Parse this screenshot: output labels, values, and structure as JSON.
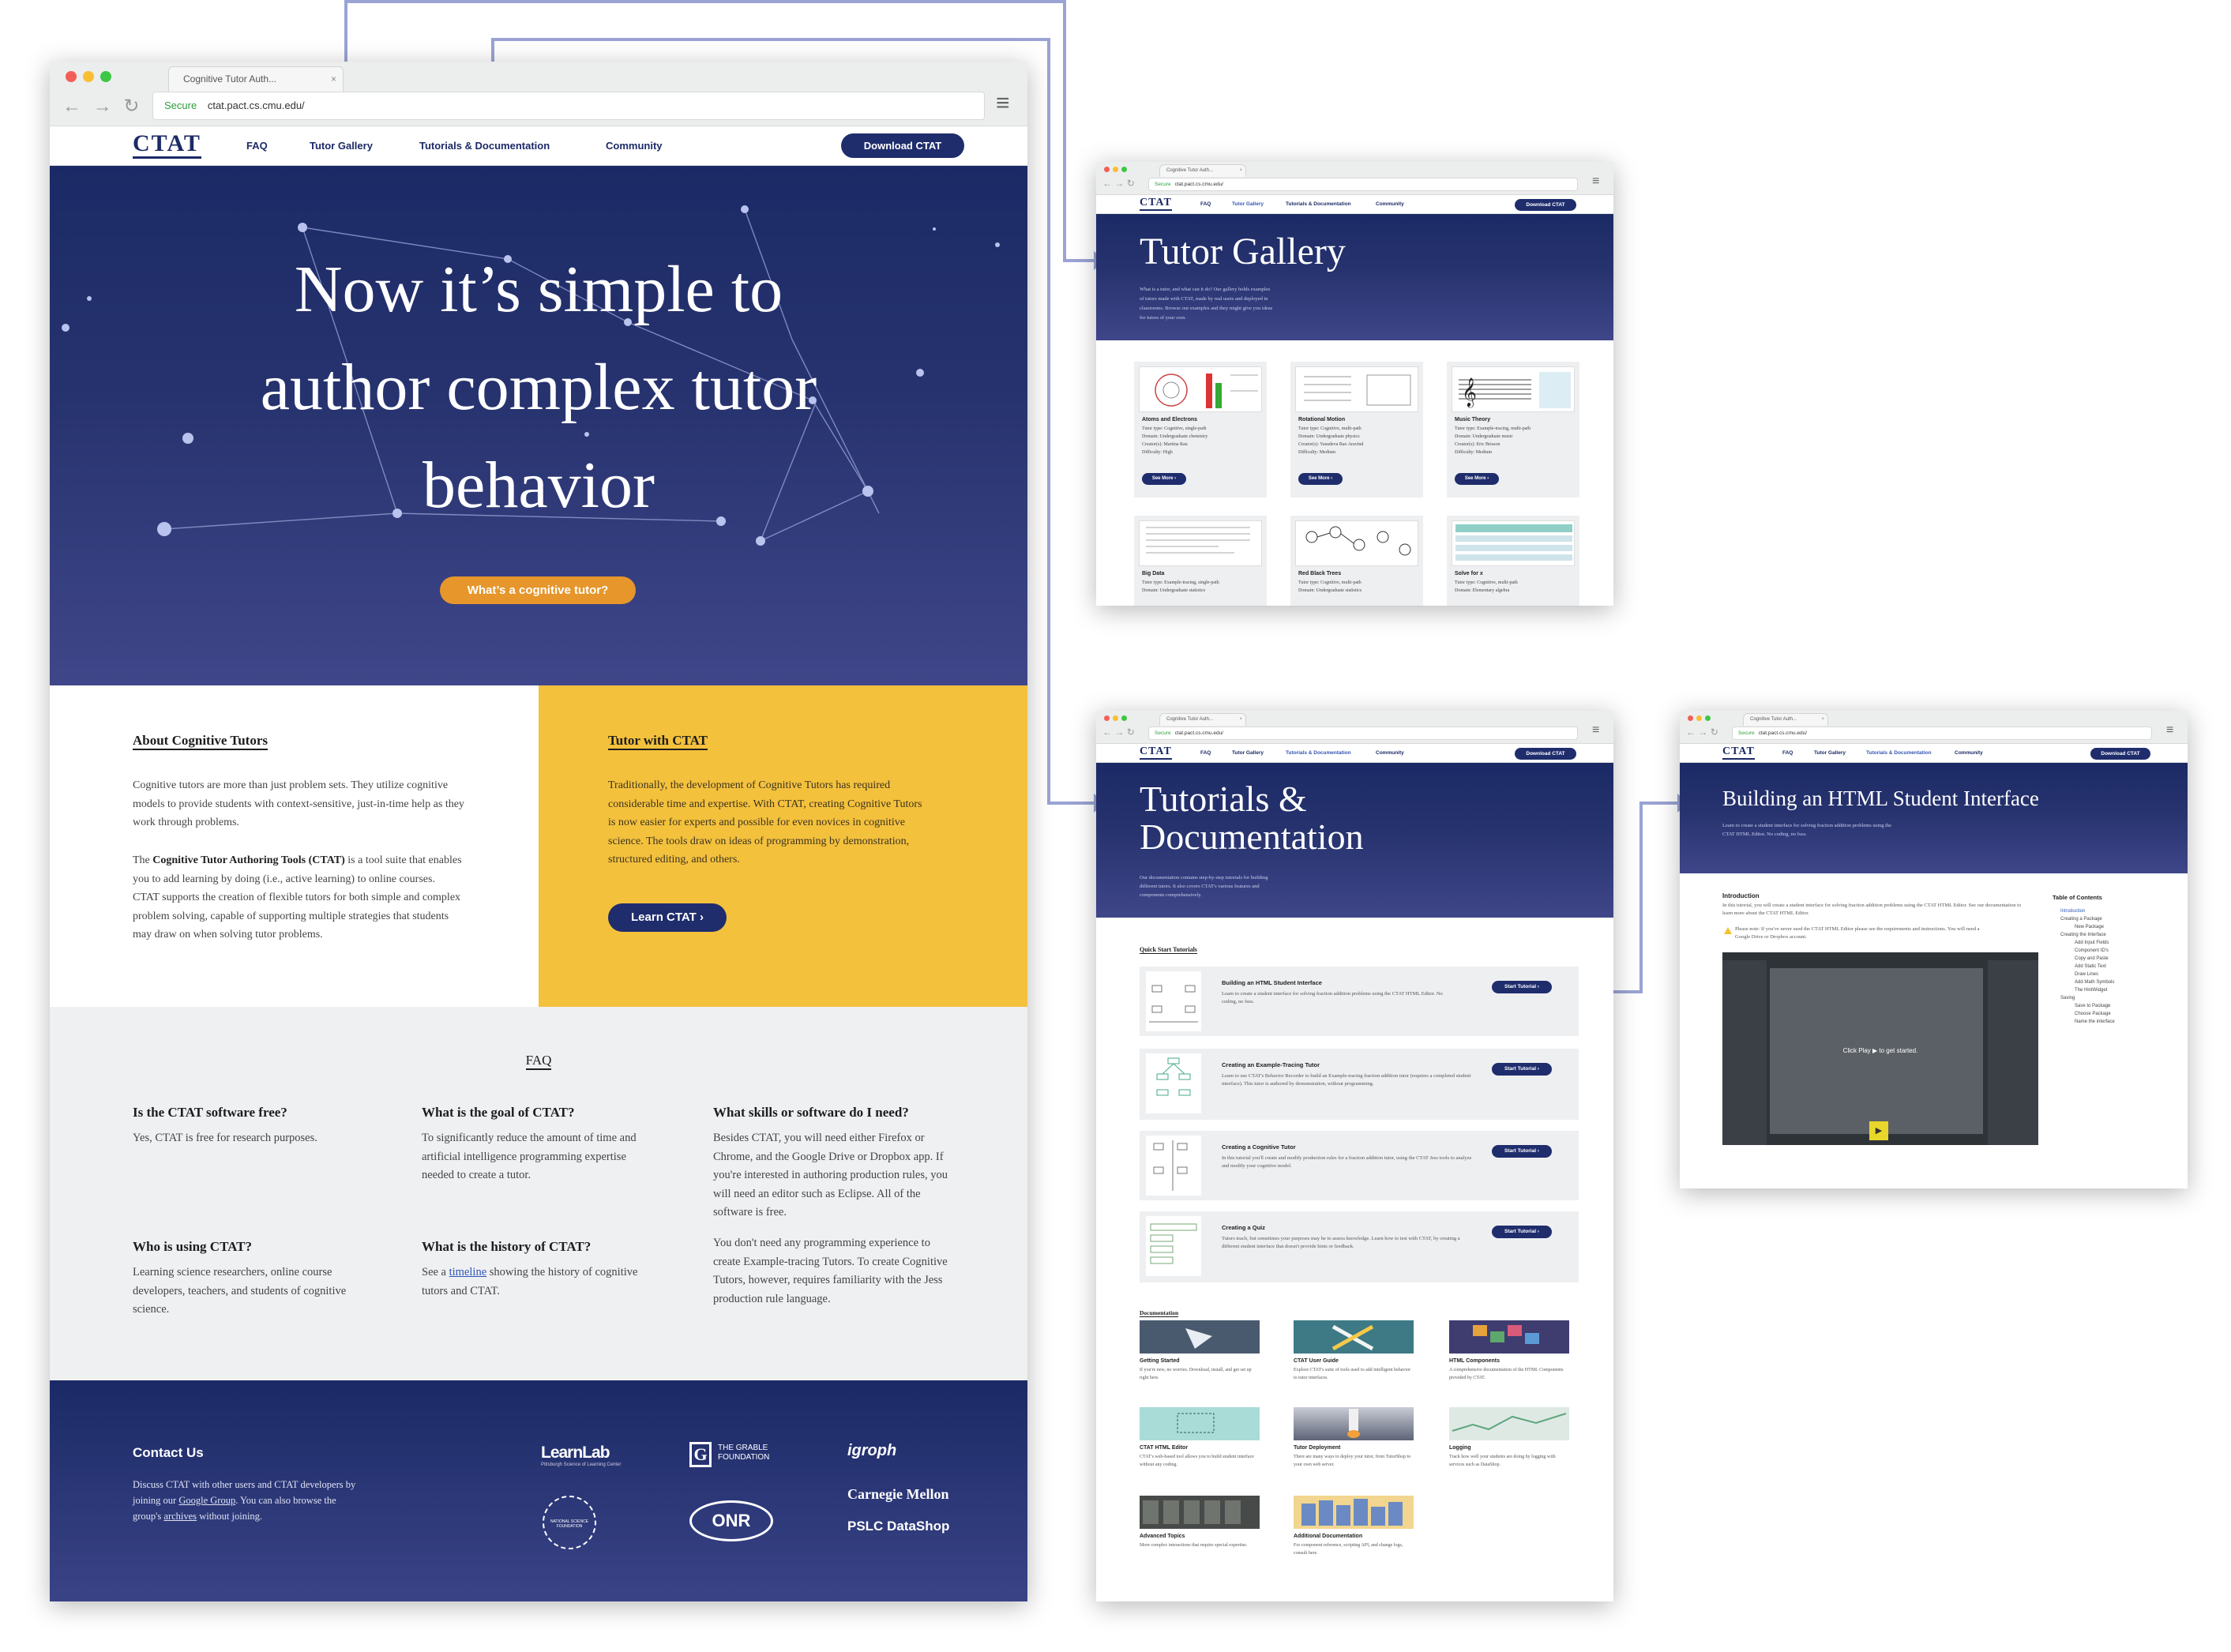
{
  "browser": {
    "tab_title": "Cognitive Tutor Auth...",
    "tab_close": "×",
    "secure": "Secure",
    "url": "ctat.pact.cs.cmu.edu/",
    "back": "←",
    "forward": "→",
    "reload": "↻",
    "menu": "≡"
  },
  "nav": {
    "logo": "CTAT",
    "logo_accent": "T",
    "faq": "FAQ",
    "gallery": "Tutor Gallery",
    "tutorials": "Tutorials & Documentation",
    "community": "Community",
    "download": "Download CTAT"
  },
  "hero": {
    "title_line1": "Now it’s simple to",
    "title_line2": "author complex tutor",
    "title_line3": "behavior",
    "cta": "What’s a cognitive tutor?"
  },
  "about": {
    "title": "About Cognitive Tutors",
    "p1": "Cognitive tutors are more than just problem sets. They utilize cognitive models to provide students with context-sensitive, just-in-time help as they work through problems.",
    "p2_pre": "The ",
    "p2_bold": "Cognitive Tutor Authoring Tools (CTAT)",
    "p2_post": " is a tool suite that enables you to add learning by doing (i.e., active learning) to online courses. CTAT supports the creation of flexible tutors for both simple and complex problem solving, capable of supporting multiple strategies that students may draw on when solving tutor problems."
  },
  "tutor_with": {
    "title": "Tutor with CTAT",
    "p": "Traditionally, the development of Cognitive Tutors has required considerable time and expertise. With CTAT, creating Cognitive Tutors is now easier for experts and possible for even novices in cognitive science. The tools draw on ideas of programming by demonstration, structured editing, and others.",
    "button": "Learn CTAT ›"
  },
  "faq": {
    "title": "FAQ",
    "q1": "Is the CTAT software free?",
    "a1": "Yes, CTAT is free for research purposes.",
    "q2": "What is the goal of CTAT?",
    "a2": "To significantly reduce the amount of time and artificial intelligence programming expertise needed to create a tutor.",
    "q3": "What skills or software do I need?",
    "a3a": "Besides CTAT, you will need either Firefox or Chrome, and the Google Drive or Dropbox app. If you're interested in authoring production rules, you will need an editor such as Eclipse. All of the software is free.",
    "a3b": "You don't need any programming experience to create Example-tracing Tutors. To create Cognitive Tutors, however, requires familiarity with the Jess production rule language.",
    "q4": "Who is using CTAT?",
    "a4": "Learning science researchers, online course developers, teachers, and students of cognitive science.",
    "q5": "What is the history of CTAT?",
    "a5_pre": "See a ",
    "a5_link": "timeline",
    "a5_post": " showing the history of cognitive tutors and CTAT."
  },
  "footer": {
    "title": "Contact Us",
    "p_pre": "Discuss CTAT with other users and CTAT developers by joining our ",
    "link1": "Google Group",
    "p_mid": ". You can also browse the group's ",
    "link2": "archives",
    "p_post": " without joining.",
    "logo1": "LearnLab",
    "logo1_sub": "Pittsburgh Science of Learning Center",
    "logo2": "THE GRABLE FOUNDATION",
    "logo3": "igroph",
    "logo4": "NATIONAL SCIENCE FOUNDATION",
    "logo5": "ONR",
    "logo6": "Carnegie Mellon",
    "logo7": "PSLC DataShop"
  },
  "gallery": {
    "title": "Tutor Gallery",
    "desc": "What is a tutor, and what can it do? Our gallery holds examples of tutors made with CTAT, made by real users and deployed in classrooms. Browse our examples and they might give you ideas for tutors of your own.",
    "see_more": "See More ›",
    "cards": [
      {
        "name": "Atoms and Electrons",
        "l1": "Tutor type: Cognitive, single-path",
        "l2": "Domain: Undergraduate chemistry",
        "l3": "Creator(s): Martina Rau",
        "l4": "Difficulty: High"
      },
      {
        "name": "Rotational Motion",
        "l1": "Tutor type: Cognitive, multi-path",
        "l2": "Domain: Undergraduate physics",
        "l3": "Creator(s): Vasudeva Rao Aravind",
        "l4": "Difficulty: Medium"
      },
      {
        "name": "Music Theory",
        "l1": "Tutor type: Example-tracing, multi-path",
        "l2": "Domain: Undergraduate music",
        "l3": "Creator(s): Eric Brisson",
        "l4": "Difficulty: Medium"
      },
      {
        "name": "Big Data",
        "l1": "Tutor type: Example-tracing, single-path",
        "l2": "Domain: Undergraduate statistics",
        "l3": "",
        "l4": ""
      },
      {
        "name": "Red Black Trees",
        "l1": "Tutor type: Cognitive, multi-path",
        "l2": "Domain: Undergraduate statistics",
        "l3": "",
        "l4": ""
      },
      {
        "name": "Solve for x",
        "l1": "Tutor type: Cognitive, multi-path",
        "l2": "Domain: Elementary algebra",
        "l3": "",
        "l4": ""
      }
    ]
  },
  "tutorials": {
    "title_line1": "Tutorials &",
    "title_line2": "Documentation",
    "desc": "Our documentation contains step-by-step tutorials for building different tutors. It also covers CTAT's various features and components comprehensively.",
    "quick_start": "Quick Start Tutorials",
    "start": "Start Tutorial ›",
    "items": [
      {
        "title": "Building an HTML Student Interface",
        "desc": "Learn to create a student interface for solving fraction addition problems using the CTAT HTML Editor. No coding, no fuss."
      },
      {
        "title": "Creating an Example-Tracing Tutor",
        "desc": "Learn to use CTAT's Behavior Recorder to build an Example-tracing fraction addition tutor (requires a completed student interface). This tutor is authored by demonstration, without programming."
      },
      {
        "title": "Creating a Cognitive Tutor",
        "desc": "In this tutorial you'll create and modify production rules for a fraction addition tutor, using the CTAT Jess tools to analyze and modify your cognitive model."
      },
      {
        "title": "Creating a Quiz",
        "desc": "Tutors teach, but sometimes your purposes may be to assess knowledge. Learn how to test with CTAT, by creating a different student interface that doesn't provide hints or feedback."
      }
    ],
    "docs_title": "Documentation",
    "docs": [
      {
        "title": "Getting Started",
        "desc": "If you're new, no worries. Download, install, and get set up right here.",
        "color": "#4a5a6e"
      },
      {
        "title": "CTAT User Guide",
        "desc": "Explore CTAT's suite of tools used to add intelligent behavior to tutor interfaces.",
        "color": "#3d7a85"
      },
      {
        "title": "HTML Components",
        "desc": "A comprehensive documentation of the HTML Components provided by CTAT.",
        "color": "#3f3c70"
      },
      {
        "title": "CTAT HTML Editor",
        "desc": "CTAT's web-based tool allows you to build student interface without any coding.",
        "color": "#a9dcd6"
      },
      {
        "title": "Tutor Deployment",
        "desc": "There are many ways to deploy your tutor, from TutorShop to your own web server.",
        "color": "#5d6476"
      },
      {
        "title": "Logging",
        "desc": "Track how well your students are doing by logging with services such as DataShop.",
        "color": "#dfe9e4"
      },
      {
        "title": "Advanced Topics",
        "desc": "More complex interactions that require special expertise.",
        "color": "#474a48"
      },
      {
        "title": "Additional Documentation",
        "desc": "For component reference, scripting API, and change logs, consult here.",
        "color": "#6b8ac4"
      }
    ]
  },
  "html_tutorial": {
    "title": "Building an HTML Student Interface",
    "desc": "Learn to create a student interface for solving fraction addition problems using the CTAT HTML Editor. No coding, no fuss.",
    "intro_title": "Introduction",
    "intro_text": "In this tutorial, you will create a student interface for solving fraction addition problems using the CTAT HTML Editor. See our documentation to learn more about the CTAT HTML Editor.",
    "note": "Please note: If you've never used the CTAT HTML Editor please see the requirements and instructions. You will need a Google Drive or Dropbox account.",
    "video_text": "Click Play ▶ to get started.",
    "toc_title": "Table of Contents",
    "toc": [
      "Introduction",
      "Creating a Package",
      "New Package",
      "Creating the Interface",
      "Add Input Fields",
      "Component ID's",
      "Copy and Paste",
      "Add Static Text",
      "Draw Lines",
      "Add Math Symbols",
      "The HintWidget",
      "Saving",
      "Save to Package",
      "Choose Package",
      "Name the interface"
    ]
  },
  "colors": {
    "navy": "#1c2a67",
    "yellow": "#f4c13d",
    "orange": "#e6962a",
    "connector": "#9aa3d3"
  }
}
